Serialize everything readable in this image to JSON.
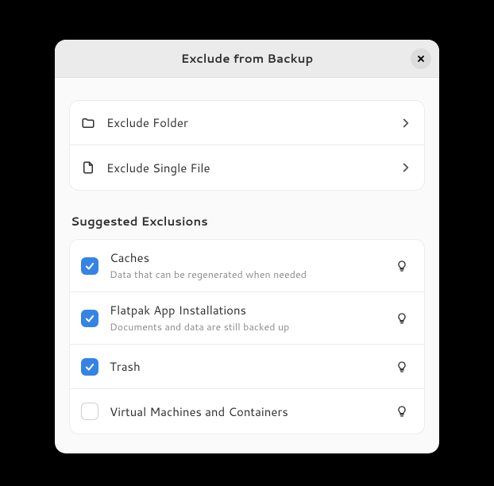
{
  "header": {
    "title": "Exclude from Backup"
  },
  "actions": {
    "items": [
      {
        "icon": "folder",
        "label": "Exclude Folder"
      },
      {
        "icon": "file",
        "label": "Exclude Single File"
      }
    ]
  },
  "suggested": {
    "title": "Suggested Exclusions",
    "items": [
      {
        "checked": true,
        "title": "Caches",
        "subtitle": "Data that can be regenerated when needed"
      },
      {
        "checked": true,
        "title": "Flatpak App Installations",
        "subtitle": "Documents and data are still backed up"
      },
      {
        "checked": true,
        "title": "Trash",
        "subtitle": ""
      },
      {
        "checked": false,
        "title": "Virtual Machines and Containers",
        "subtitle": ""
      }
    ]
  }
}
